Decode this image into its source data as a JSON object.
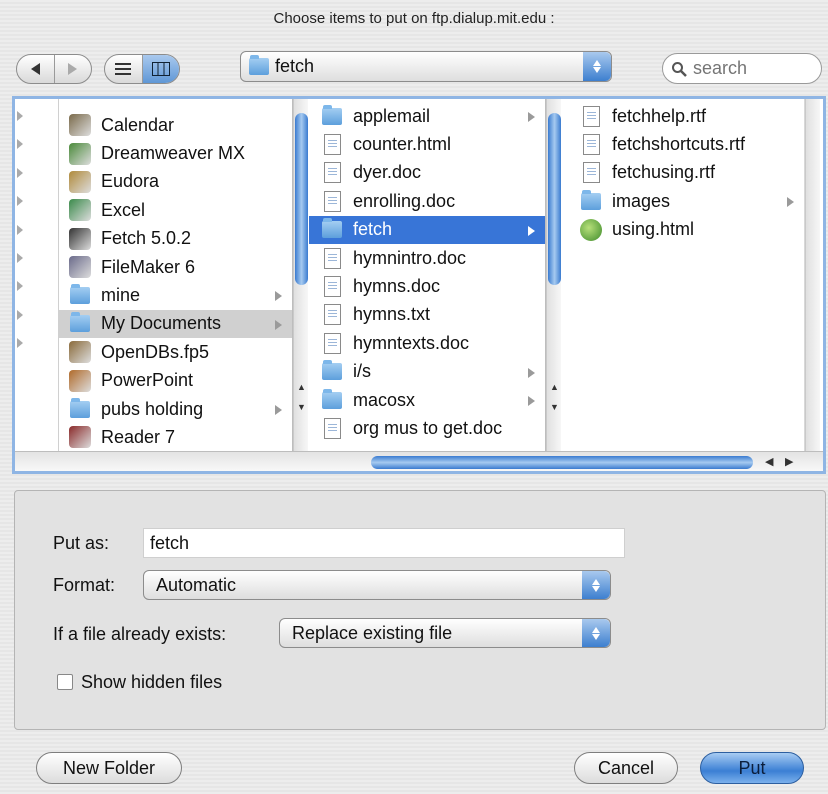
{
  "window": {
    "title": "Choose items to put on ftp.dialup.mit.edu :"
  },
  "toolbar": {
    "path_popup_value": "fetch",
    "search_placeholder": "search"
  },
  "columns": {
    "col1": [
      {
        "label": "Calendar",
        "icon": "calendar-icon",
        "color": "#7a6a4a",
        "arrow": false
      },
      {
        "label": "Dreamweaver MX",
        "icon": "dreamweaver-icon",
        "color": "#4a8a3a",
        "arrow": false
      },
      {
        "label": "Eudora",
        "icon": "eudora-icon",
        "color": "#b08a3a",
        "arrow": false
      },
      {
        "label": "Excel",
        "icon": "excel-icon",
        "color": "#3a8a4a",
        "arrow": false
      },
      {
        "label": "Fetch 5.0.2",
        "icon": "fetch-dog-icon",
        "color": "#333333",
        "arrow": false
      },
      {
        "label": "FileMaker 6",
        "icon": "filemaker-icon",
        "color": "#6a6a8a",
        "arrow": false
      },
      {
        "label": "mine",
        "icon": "folder-icon",
        "color": "",
        "arrow": true
      },
      {
        "label": "My Documents",
        "icon": "folder-icon",
        "color": "",
        "arrow": true
      },
      {
        "label": "OpenDBs.fp5",
        "icon": "database-icon",
        "color": "#8a6a3a",
        "arrow": false
      },
      {
        "label": "PowerPoint",
        "icon": "powerpoint-icon",
        "color": "#b06a2a",
        "arrow": false
      },
      {
        "label": "pubs holding",
        "icon": "folder-icon",
        "color": "",
        "arrow": true
      },
      {
        "label": "Reader 7",
        "icon": "reader-icon",
        "color": "#8a2a2a",
        "arrow": false
      }
    ],
    "col2": [
      {
        "label": "applemail",
        "icon": "folder-icon",
        "arrow": true
      },
      {
        "label": "counter.html",
        "icon": "document-icon",
        "arrow": false
      },
      {
        "label": "dyer.doc",
        "icon": "document-icon",
        "arrow": false
      },
      {
        "label": "enrolling.doc",
        "icon": "document-icon",
        "arrow": false
      },
      {
        "label": "fetch",
        "icon": "folder-icon",
        "arrow": true
      },
      {
        "label": "hymnintro.doc",
        "icon": "document-icon",
        "arrow": false
      },
      {
        "label": "hymns.doc",
        "icon": "document-icon",
        "arrow": false
      },
      {
        "label": "hymns.txt",
        "icon": "document-icon",
        "arrow": false
      },
      {
        "label": "hymntexts.doc",
        "icon": "document-icon",
        "arrow": false
      },
      {
        "label": "i/s",
        "icon": "folder-icon",
        "arrow": true
      },
      {
        "label": "macosx",
        "icon": "folder-icon",
        "arrow": true
      },
      {
        "label": "org mus to get.doc",
        "icon": "document-icon",
        "arrow": false
      }
    ],
    "col3": [
      {
        "label": "fetchhelp.rtf",
        "icon": "document-icon",
        "arrow": false
      },
      {
        "label": "fetchshortcuts.rtf",
        "icon": "document-icon",
        "arrow": false
      },
      {
        "label": "fetchusing.rtf",
        "icon": "document-icon",
        "arrow": false
      },
      {
        "label": "images",
        "icon": "folder-icon",
        "arrow": true
      },
      {
        "label": "using.html",
        "icon": "html-file-icon",
        "arrow": false
      }
    ]
  },
  "options": {
    "put_as_label": "Put as:",
    "put_as_value": "fetch",
    "format_label": "Format:",
    "format_value": "Automatic",
    "exists_label": "If a file already exists:",
    "exists_value": "Replace existing file",
    "show_hidden_label": "Show hidden files"
  },
  "buttons": {
    "new_folder": "New Folder",
    "cancel": "Cancel",
    "put": "Put"
  },
  "colors": {
    "selection": "#3875d7",
    "accent": "#5f97d6"
  }
}
